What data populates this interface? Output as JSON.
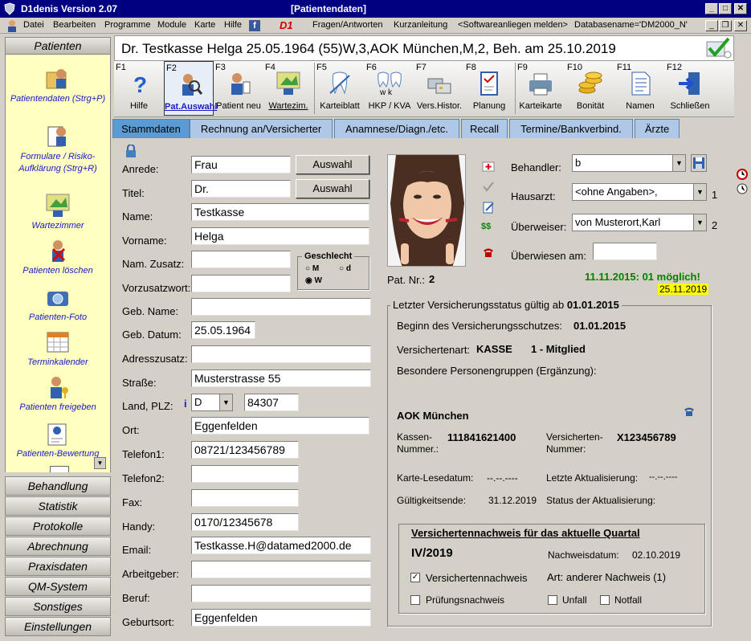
{
  "window": {
    "app_title": "D1denis Version 2.07",
    "doc_title": "[Patientendaten]"
  },
  "menu": {
    "datei": "Datei",
    "bearbeiten": "Bearbeiten",
    "programme": "Programme",
    "module": "Module",
    "karte": "Karte",
    "hilfe": "Hilfe",
    "d1": "D1",
    "fragen": "Fragen/Antworten",
    "kurz": "Kurzanleitung",
    "software": "<Softwareanliegen melden>",
    "database": "Databasename='DM2000_N'"
  },
  "sidebar": {
    "header": "Patienten",
    "items": [
      {
        "label": "Patientendaten (Strg+P)",
        "icon": "folder-person-icon"
      },
      {
        "label": "Formulare / Risiko-Aufklärung (Strg+R)",
        "icon": "form-person-icon"
      },
      {
        "label": "Wartezimmer",
        "icon": "waiting-room-icon"
      },
      {
        "label": "Patienten löschen",
        "icon": "delete-patient-icon"
      },
      {
        "label": "Patienten-Foto",
        "icon": "camera-icon"
      },
      {
        "label": "Terminkalender",
        "icon": "calendar-icon"
      },
      {
        "label": "Patienten freigeben",
        "icon": "release-patient-icon"
      },
      {
        "label": "Patienten-Bewertung",
        "icon": "rating-icon"
      }
    ],
    "sections": [
      "Behandlung",
      "Statistik",
      "Protokolle",
      "Abrechnung",
      "Praxisdaten",
      "QM-System",
      "Sonstiges",
      "Einstellungen"
    ]
  },
  "header": {
    "patient": "Dr. Testkasse Helga  25.05.1964  (55)W,3,AOK München,M,2, Beh. am 25.10.2019"
  },
  "toolbar": [
    {
      "key": "F1",
      "label": "Hilfe",
      "icon": "help-icon"
    },
    {
      "key": "F2",
      "label": "Pat.Auswahl",
      "icon": "patient-search-icon"
    },
    {
      "key": "F3",
      "label": "Patient neu",
      "icon": "new-patient-icon"
    },
    {
      "key": "F4",
      "label": "Wartezim.",
      "icon": "waiting-room-icon"
    },
    {
      "key": "F5",
      "label": "Karteiblatt",
      "icon": "tooth-card-icon"
    },
    {
      "key": "F6",
      "label": "HKP / KVA",
      "icon": "teeth-icon"
    },
    {
      "key": "F7",
      "label": "Vers.Histor.",
      "icon": "history-icon"
    },
    {
      "key": "F8",
      "label": "Planung",
      "icon": "planning-icon"
    },
    {
      "key": "F9",
      "label": "Karteikarte",
      "icon": "printer-icon"
    },
    {
      "key": "F10",
      "label": "Bonität",
      "icon": "coins-icon"
    },
    {
      "key": "F11",
      "label": "Namen",
      "icon": "document-icon"
    },
    {
      "key": "F12",
      "label": "Schließen",
      "icon": "exit-door-icon"
    }
  ],
  "tabs": [
    "Stammdaten",
    "Rechnung an/Versicherter",
    "Anamnese/Diagn./etc.",
    "Recall",
    "Termine/Bankverbind.",
    "Ärzte"
  ],
  "form": {
    "anrede_label": "Anrede:",
    "anrede": "Frau",
    "auswahl": "Auswahl",
    "titel_label": "Titel:",
    "titel": "Dr.",
    "name_label": "Name:",
    "name": "Testkasse",
    "vorname_label": "Vorname:",
    "vorname": "Helga",
    "namzusatz_label": "Nam. Zusatz:",
    "namzusatz": "",
    "vorzusatz_label": "Vorzusatzwort:",
    "vorzusatz": "",
    "geschlecht_label": "Geschlecht",
    "g_m": "M",
    "g_d": "d",
    "g_w": "W",
    "gebname_label": "Geb. Name:",
    "gebname": "",
    "gebdatum_label": "Geb. Datum:",
    "gebdatum": "25.05.1964",
    "adresszusatz_label": "Adresszusatz:",
    "adresszusatz": "",
    "strasse_label": "Straße:",
    "strasse": "Musterstrasse 55",
    "landplz_label": "Land, PLZ:",
    "info": "i",
    "land": "D",
    "plz": "84307",
    "ort_label": "Ort:",
    "ort": "Eggenfelden",
    "telefon1_label": "Telefon1:",
    "telefon1": "08721/123456789",
    "telefon2_label": "Telefon2:",
    "telefon2": "",
    "fax_label": "Fax:",
    "fax": "",
    "handy_label": "Handy:",
    "handy": "0170/12345678",
    "email_label": "Email:",
    "email": "Testkasse.H@datamed2000.de",
    "arbeitgeber_label": "Arbeitgeber:",
    "arbeitgeber": "",
    "beruf_label": "Beruf:",
    "beruf": "",
    "geburtsort_label": "Geburtsort:",
    "geburtsort": "Eggenfelden"
  },
  "right": {
    "behandler_label": "Behandler:",
    "behandler": "b",
    "hausarzt_label": "Hausarzt:",
    "hausarzt": "<ohne Angaben>,",
    "hausarzt_num": "1",
    "ueberweiser_label": "Überweiser:",
    "ueberweiser": "von Musterort,Karl",
    "ueberweiser_num": "2",
    "ueberwiesen_label": "Überwiesen am:",
    "ueberwiesen": "",
    "patnr_label": "Pat. Nr.:",
    "patnr": "2",
    "status_green": "11.11.2015: 01 möglich!",
    "status_date": "25.11.2019"
  },
  "insurance": {
    "legend": "Letzter Versicherungsstatus gültig ab",
    "legend_date": "01.01.2015",
    "beginn_label": "Beginn des Versicherungsschutzes:",
    "beginn": "01.01.2015",
    "art_label": "Versichertenart:",
    "art": "KASSE",
    "art2": "1 - Mitglied",
    "besondere": "Besondere Personengruppen (Ergänzung):",
    "kasse": "AOK München",
    "kassen_label1": "Kassen-",
    "kassen_label2": "Nummer.:",
    "kassen_nr": "111841621400",
    "versicherten_label1": "Versicherten-",
    "versicherten_label2": "Nummer:",
    "versicherten_nr": "X123456789",
    "karte_label": "Karte-Lesedatum:",
    "karte": "--.--.----",
    "letzte_label": "Letzte Aktualisierung:",
    "letzte": "--.--.----",
    "gueltig_label": "Gültigkeitsende:",
    "gueltig": "31.12.2019",
    "status_label": "Status der Aktualisierung:"
  },
  "nachweis": {
    "title": "Versichertennachweis für das aktuelle Quartal",
    "quartal": "IV/2019",
    "datum_label": "Nachweisdatum:",
    "datum": "02.10.2019",
    "vn_label": "Versichertennachweis",
    "vn_checked": true,
    "art": "Art:  anderer Nachweis (1)",
    "pruef_label": "Prüfungsnachweis",
    "unfall_label": "Unfall",
    "notfall_label": "Notfall"
  },
  "colors": {
    "titlebar": "#000080",
    "sidebar_pane": "#ffffc0",
    "sidebar_text": "#1a1ac8",
    "tab_active": "#5b9bd5",
    "tab": "#b0c8e8",
    "green": "#008000",
    "yellow": "#ffff00"
  }
}
